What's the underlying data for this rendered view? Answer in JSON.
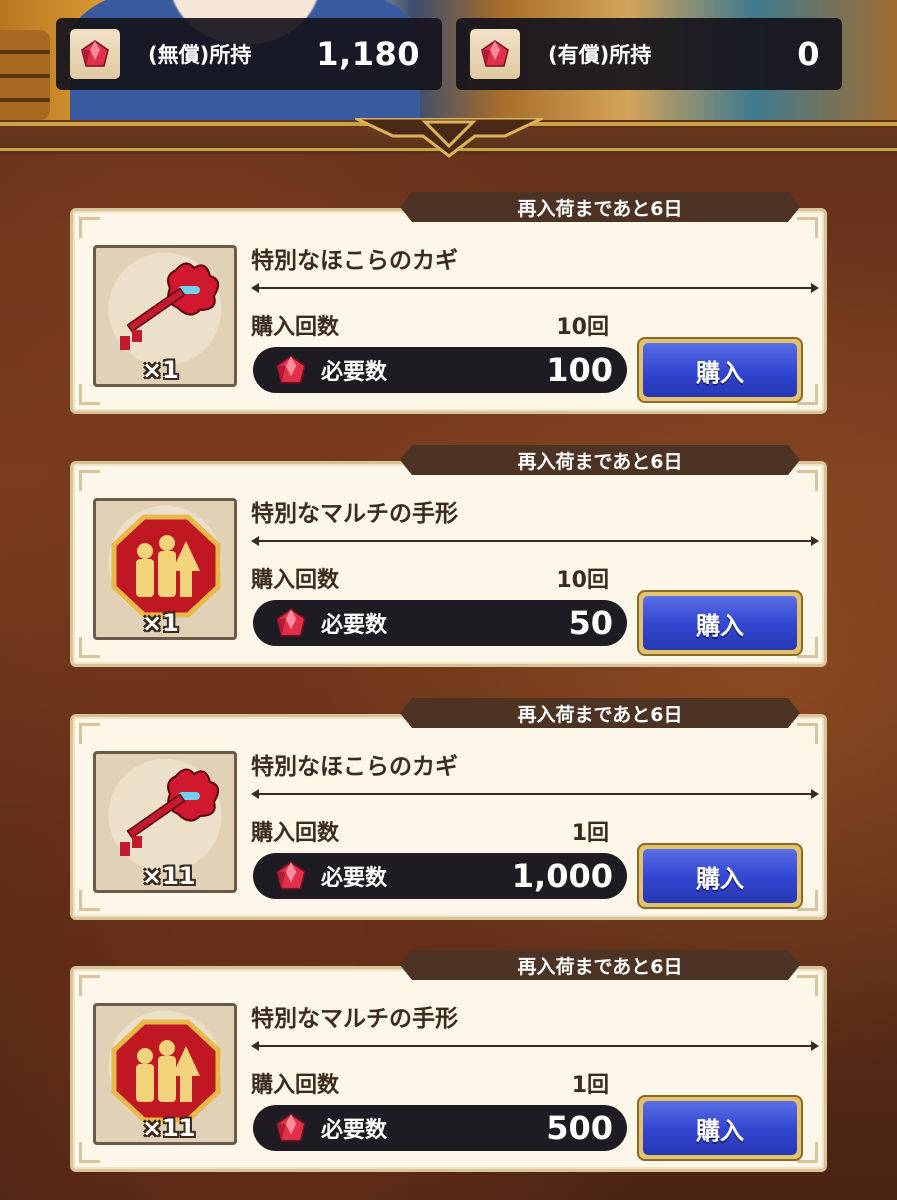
{
  "header": {
    "free_currency": {
      "label": "(無償)所持",
      "value": "1,180",
      "icon": "red-gem-icon"
    },
    "paid_currency": {
      "label": "(有償)所持",
      "value": "0",
      "icon": "red-gem-icon"
    }
  },
  "items": [
    {
      "restock": "再入荷まであと6日",
      "name": "特別なほこらのカギ",
      "quantity": "×1",
      "icon": "red-key-icon",
      "count_label": "購入回数",
      "count_value": "10回",
      "cost_label": "必要数",
      "cost_value": "100",
      "buy_label": "購入"
    },
    {
      "restock": "再入荷まであと6日",
      "name": "特別なマルチの手形",
      "quantity": "×1",
      "icon": "multi-pass-medal-icon",
      "count_label": "購入回数",
      "count_value": "10回",
      "cost_label": "必要数",
      "cost_value": "50",
      "buy_label": "購入"
    },
    {
      "restock": "再入荷まであと6日",
      "name": "特別なほこらのカギ",
      "quantity": "×11",
      "icon": "red-key-icon",
      "count_label": "購入回数",
      "count_value": "1回",
      "cost_label": "必要数",
      "cost_value": "1,000",
      "buy_label": "購入"
    },
    {
      "restock": "再入荷まであと6日",
      "name": "特別なマルチの手形",
      "quantity": "×11",
      "icon": "multi-pass-medal-icon",
      "count_label": "購入回数",
      "count_value": "1回",
      "cost_label": "必要数",
      "cost_value": "500",
      "buy_label": "購入"
    }
  ],
  "colors": {
    "buy_button": "#3447d2",
    "panel": "#fcf7e8",
    "restock_tab": "#4d3324",
    "gem": "#e0304a"
  }
}
